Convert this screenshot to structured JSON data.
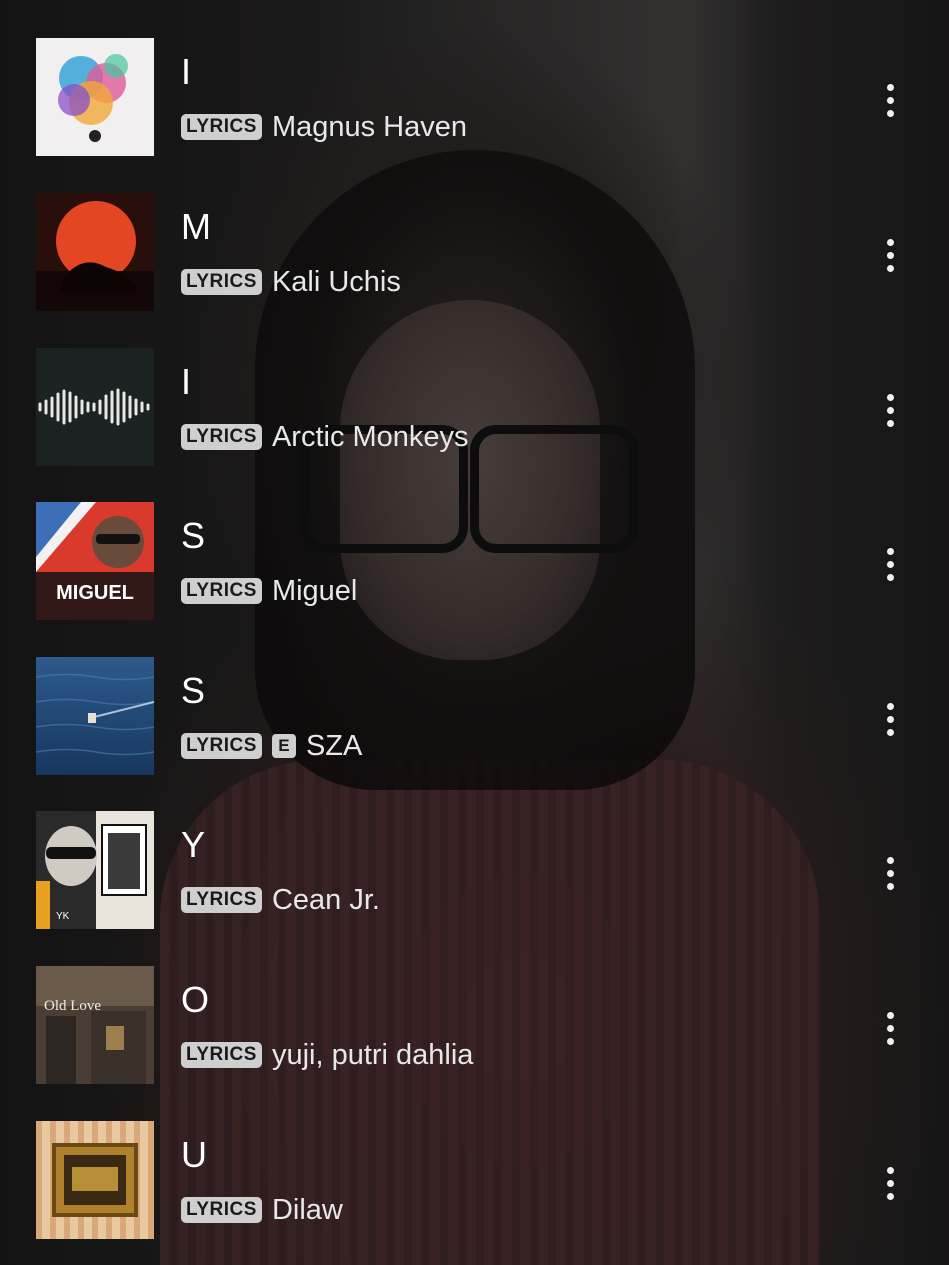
{
  "tracks": [
    {
      "title": "I",
      "badge": "LYRICS",
      "explicit": false,
      "explicit_label": "",
      "artist": "Magnus Haven",
      "art_icon": "album-art-magnus-haven"
    },
    {
      "title": "M",
      "badge": "LYRICS",
      "explicit": false,
      "explicit_label": "",
      "artist": "Kali Uchis",
      "art_icon": "album-art-kali-uchis"
    },
    {
      "title": "I",
      "badge": "LYRICS",
      "explicit": false,
      "explicit_label": "",
      "artist": "Arctic Monkeys",
      "art_icon": "album-art-arctic-monkeys"
    },
    {
      "title": "S",
      "badge": "LYRICS",
      "explicit": false,
      "explicit_label": "",
      "artist": "Miguel",
      "art_icon": "album-art-miguel",
      "art_text": "MIGUEL"
    },
    {
      "title": "S",
      "badge": "LYRICS",
      "explicit": true,
      "explicit_label": "E",
      "artist": "SZA",
      "art_icon": "album-art-sza"
    },
    {
      "title": "Y",
      "badge": "LYRICS",
      "explicit": false,
      "explicit_label": "",
      "artist": "Cean Jr.",
      "art_icon": "album-art-cean-jr",
      "art_text": "YK"
    },
    {
      "title": "O",
      "badge": "LYRICS",
      "explicit": false,
      "explicit_label": "",
      "artist": "yuji, putri dahlia",
      "art_icon": "album-art-old-love",
      "art_text": "Old Love"
    },
    {
      "title": "U",
      "badge": "LYRICS",
      "explicit": false,
      "explicit_label": "",
      "artist": "Dilaw",
      "art_icon": "album-art-dilaw"
    }
  ],
  "colors": {
    "text_primary": "#ffffff",
    "badge_bg": "#cfcfcf",
    "badge_text": "#1a1a1a"
  }
}
